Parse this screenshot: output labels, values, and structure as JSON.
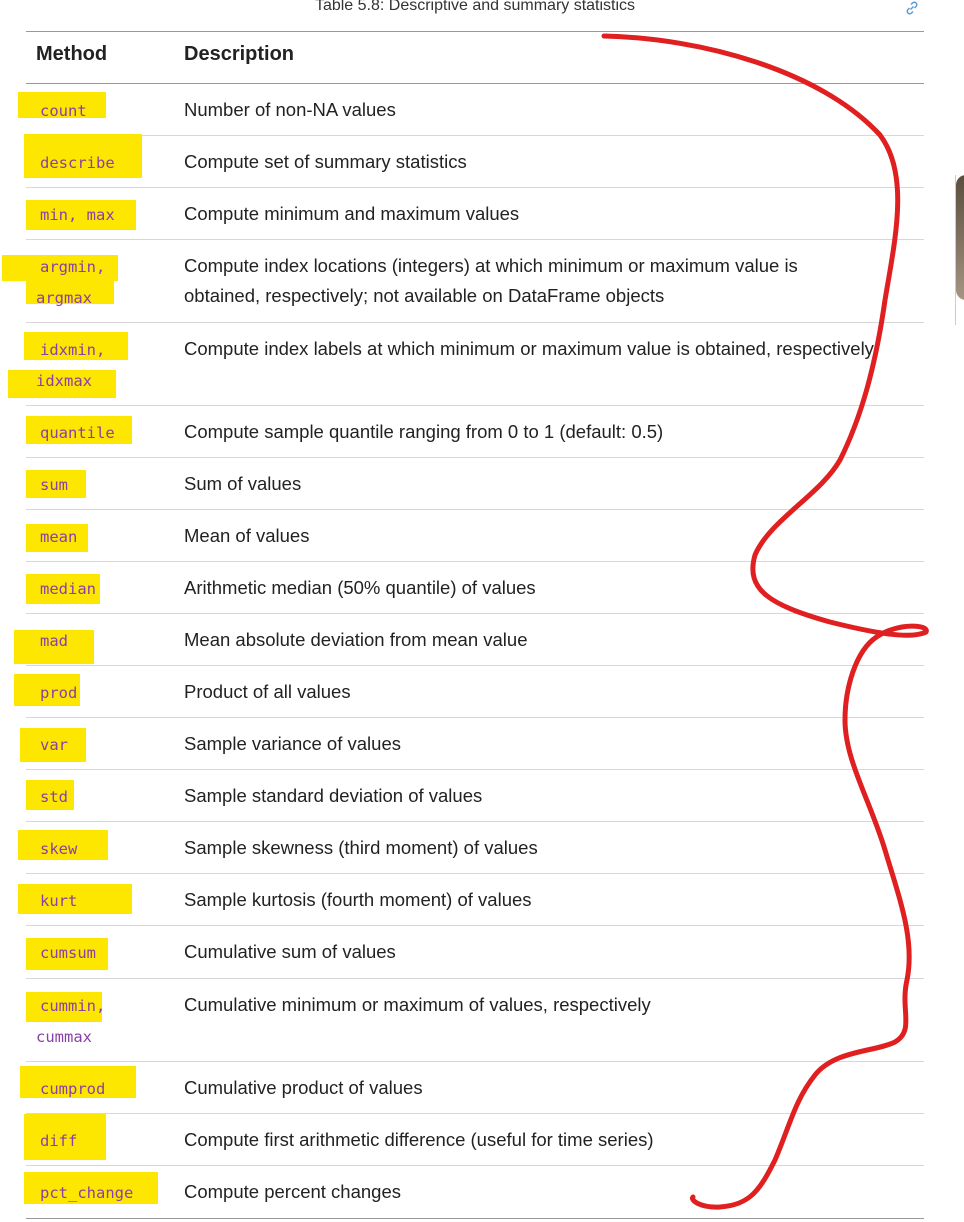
{
  "table": {
    "caption": "Table 5.8: Descriptive and summary statistics",
    "headers": {
      "method": "Method",
      "description": "Description"
    },
    "rows": [
      {
        "methods": [
          "count"
        ],
        "description": "Number of non-NA values"
      },
      {
        "methods": [
          "describe"
        ],
        "description": "Compute set of summary statistics"
      },
      {
        "methods": [
          "min, max"
        ],
        "description": "Compute minimum and maximum values"
      },
      {
        "methods": [
          "argmin,",
          "argmax"
        ],
        "description": "Compute index locations (integers) at which minimum or maximum value is obtained, respectively; not available on DataFrame objects"
      },
      {
        "methods": [
          "idxmin,",
          "idxmax"
        ],
        "description": "Compute index labels at which minimum or maximum value is obtained, respectively"
      },
      {
        "methods": [
          "quantile"
        ],
        "description": "Compute sample quantile ranging from 0 to 1 (default: 0.5)"
      },
      {
        "methods": [
          "sum"
        ],
        "description": "Sum of values"
      },
      {
        "methods": [
          "mean"
        ],
        "description": "Mean of values"
      },
      {
        "methods": [
          "median"
        ],
        "description": "Arithmetic median (50% quantile) of values"
      },
      {
        "methods": [
          "mad"
        ],
        "description": "Mean absolute deviation from mean value"
      },
      {
        "methods": [
          "prod"
        ],
        "description": "Product of all values"
      },
      {
        "methods": [
          "var"
        ],
        "description": "Sample variance of values"
      },
      {
        "methods": [
          "std"
        ],
        "description": "Sample standard deviation of values"
      },
      {
        "methods": [
          "skew"
        ],
        "description": "Sample skewness (third moment) of values"
      },
      {
        "methods": [
          "kurt"
        ],
        "description": "Sample kurtosis (fourth moment) of values"
      },
      {
        "methods": [
          "cumsum"
        ],
        "description": "Cumulative sum of values"
      },
      {
        "methods": [
          "cummin,",
          "cummax"
        ],
        "description": "Cumulative minimum or maximum of values, respectively"
      },
      {
        "methods": [
          "cumprod"
        ],
        "description": "Cumulative product of values"
      },
      {
        "methods": [
          "diff"
        ],
        "description": "Compute first arithmetic difference (useful for time series)"
      },
      {
        "methods": [
          "pct_change"
        ],
        "description": "Compute percent changes"
      }
    ]
  },
  "colors": {
    "highlight": "#fde600",
    "code_text": "#8a3fa8",
    "ink": "#e02020",
    "link": "#5b9bd5"
  },
  "icons": {
    "anchor": "link-icon"
  }
}
